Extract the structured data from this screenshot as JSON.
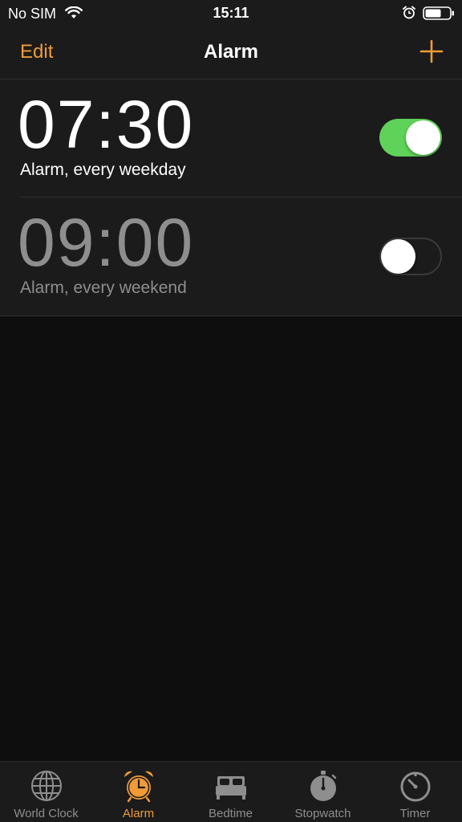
{
  "status_bar": {
    "carrier": "No SIM",
    "time": "15:11",
    "icons": [
      "wifi-icon",
      "alarm-icon",
      "battery-icon"
    ]
  },
  "nav": {
    "edit_label": "Edit",
    "title": "Alarm",
    "add_icon": "plus-icon"
  },
  "alarms": [
    {
      "time": "07:30",
      "label": "Alarm, every weekday",
      "enabled": true
    },
    {
      "time": "09:00",
      "label": "Alarm, every weekend",
      "enabled": false
    }
  ],
  "tabs": [
    {
      "label": "World Clock",
      "icon": "globe-icon",
      "active": false
    },
    {
      "label": "Alarm",
      "icon": "alarm-clock-icon",
      "active": true
    },
    {
      "label": "Bedtime",
      "icon": "bed-icon",
      "active": false
    },
    {
      "label": "Stopwatch",
      "icon": "stopwatch-icon",
      "active": false
    },
    {
      "label": "Timer",
      "icon": "timer-icon",
      "active": false
    }
  ],
  "colors": {
    "accent": "#f19a38",
    "toggle_on": "#5fd25a",
    "background": "#0e0e0e",
    "surface": "#1b1b1b"
  }
}
